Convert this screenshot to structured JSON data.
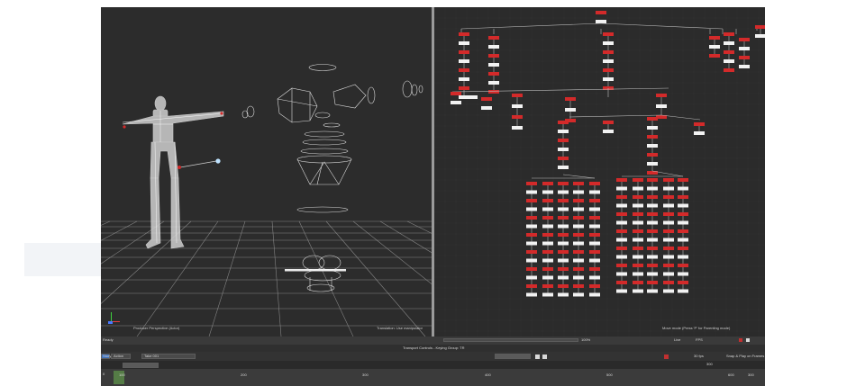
{
  "viewport": {
    "label_left": "Producer Perspective (Actor)",
    "label_right": "Translation: Use manipulator"
  },
  "schematic": {
    "status": "Move mode (Press 'P' for Parenting mode)"
  },
  "statusbar": {
    "left": "Ready",
    "zoom": "100%",
    "right_items": [
      "Live",
      "FPS"
    ]
  },
  "transport": {
    "title": "Transport Controls - Keying Group: TR",
    "tabs": [
      "Story",
      "Action"
    ],
    "take": "Take 001",
    "fps_label": "30 fps",
    "snap_label": "Snap & Play on Frames",
    "end_frame": "300"
  },
  "timeline": {
    "tick_labels": [
      "100",
      "200",
      "300",
      "400",
      "500",
      "600"
    ],
    "start_label": "0",
    "end_label": "300"
  },
  "colors": {
    "node_red": "#d32a2a",
    "node_white": "#f2f2f2",
    "panel_bg": "#2c2c2c"
  },
  "icons": [
    "axis-gizmo-icon",
    "play-icon",
    "record-icon",
    "key-icon"
  ]
}
